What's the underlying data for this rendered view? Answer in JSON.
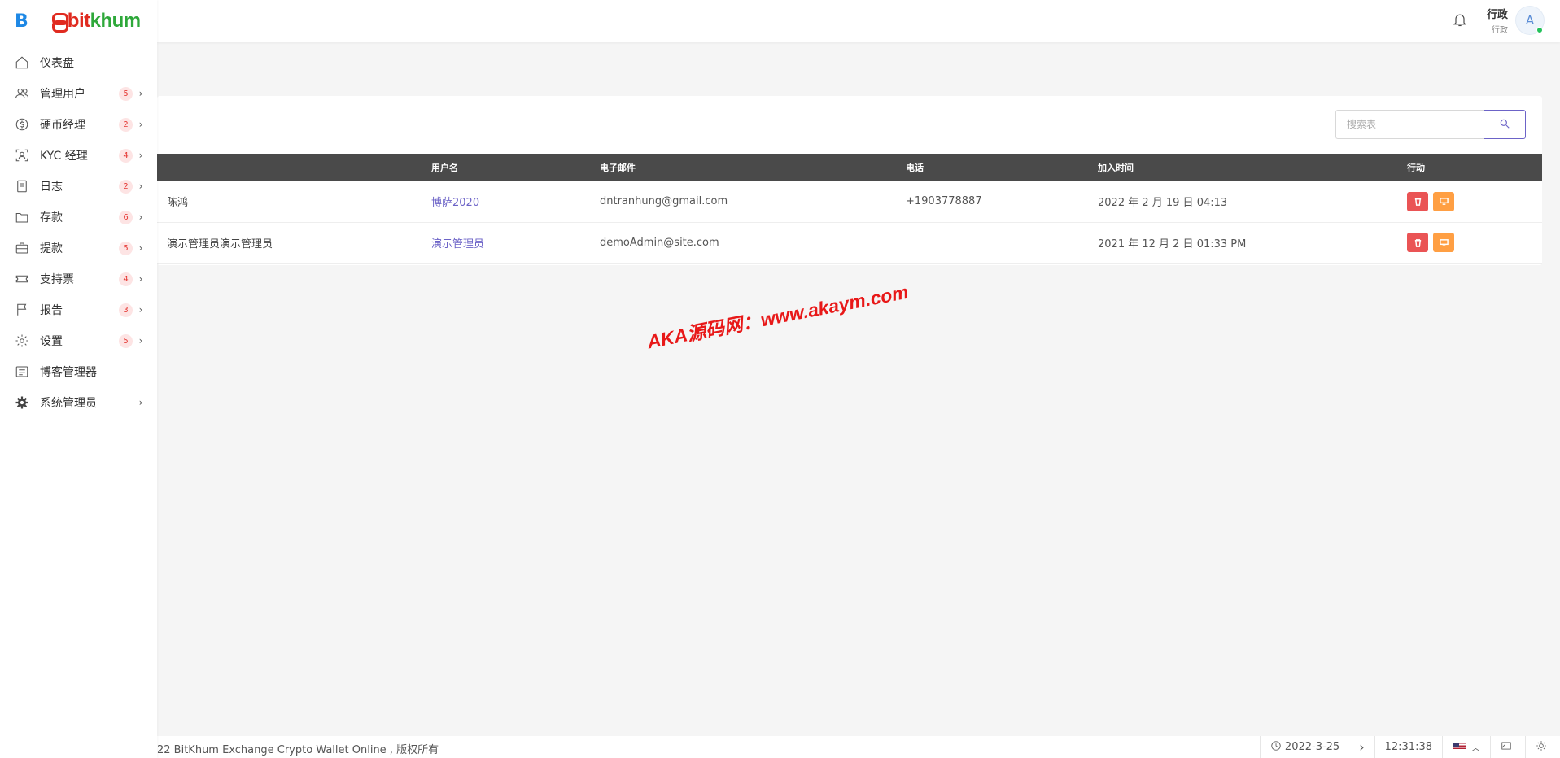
{
  "brand": {
    "initial": "B",
    "name_part1": "bit",
    "name_part2": "khum"
  },
  "sidebar": {
    "items": [
      {
        "label": "仪表盘",
        "icon": "home-icon",
        "badge": ""
      },
      {
        "label": "管理用户",
        "icon": "users-icon",
        "badge": "5"
      },
      {
        "label": "硬币经理",
        "icon": "coin-icon",
        "badge": "2"
      },
      {
        "label": "KYC 经理",
        "icon": "id-scan-icon",
        "badge": "4"
      },
      {
        "label": "日志",
        "icon": "notebook-icon",
        "badge": "2"
      },
      {
        "label": "存款",
        "icon": "folder-icon",
        "badge": "6"
      },
      {
        "label": "提款",
        "icon": "briefcase-icon",
        "badge": "5"
      },
      {
        "label": "支持票",
        "icon": "ticket-icon",
        "badge": "4"
      },
      {
        "label": "报告",
        "icon": "flag-icon",
        "badge": "3"
      },
      {
        "label": "设置",
        "icon": "gear-icon",
        "badge": "5"
      },
      {
        "label": "博客管理器",
        "icon": "article-icon",
        "badge": ""
      },
      {
        "label": "系统管理员",
        "icon": "cog-filled-icon",
        "badge": ""
      }
    ]
  },
  "header": {
    "user_name": "行政",
    "user_role": "行政",
    "avatar_letter": "A"
  },
  "search": {
    "placeholder": "搜索表"
  },
  "table": {
    "headers": [
      "",
      "用户名",
      "电子邮件",
      "电话",
      "加入时间",
      "行动"
    ],
    "rows": [
      {
        "name": "陈鸿",
        "username": "博萨2020",
        "email": "dntranhung@gmail.com",
        "phone": "+1903778887",
        "joined": "2022 年 2 月 19 日 04:13"
      },
      {
        "name": "演示管理员演示管理员",
        "username": "演示管理员",
        "email": "demoAdmin@site.com",
        "phone": "",
        "joined": "2021 年 12 月 2 日 01:33 PM"
      }
    ]
  },
  "watermark": "AKA源码网：www.akaym.com",
  "footer": {
    "copyright": "22  BitKhum Exchange Crypto Wallet Online , 版权所有",
    "date": "2022-3-25",
    "time": "12:31:38"
  },
  "colors": {
    "accent": "#6c63c7",
    "danger": "#ea5455",
    "warning": "#ff9f43",
    "table_header": "#4a4a4a",
    "brand_red": "#e02b20",
    "brand_green": "#2ea83a"
  }
}
